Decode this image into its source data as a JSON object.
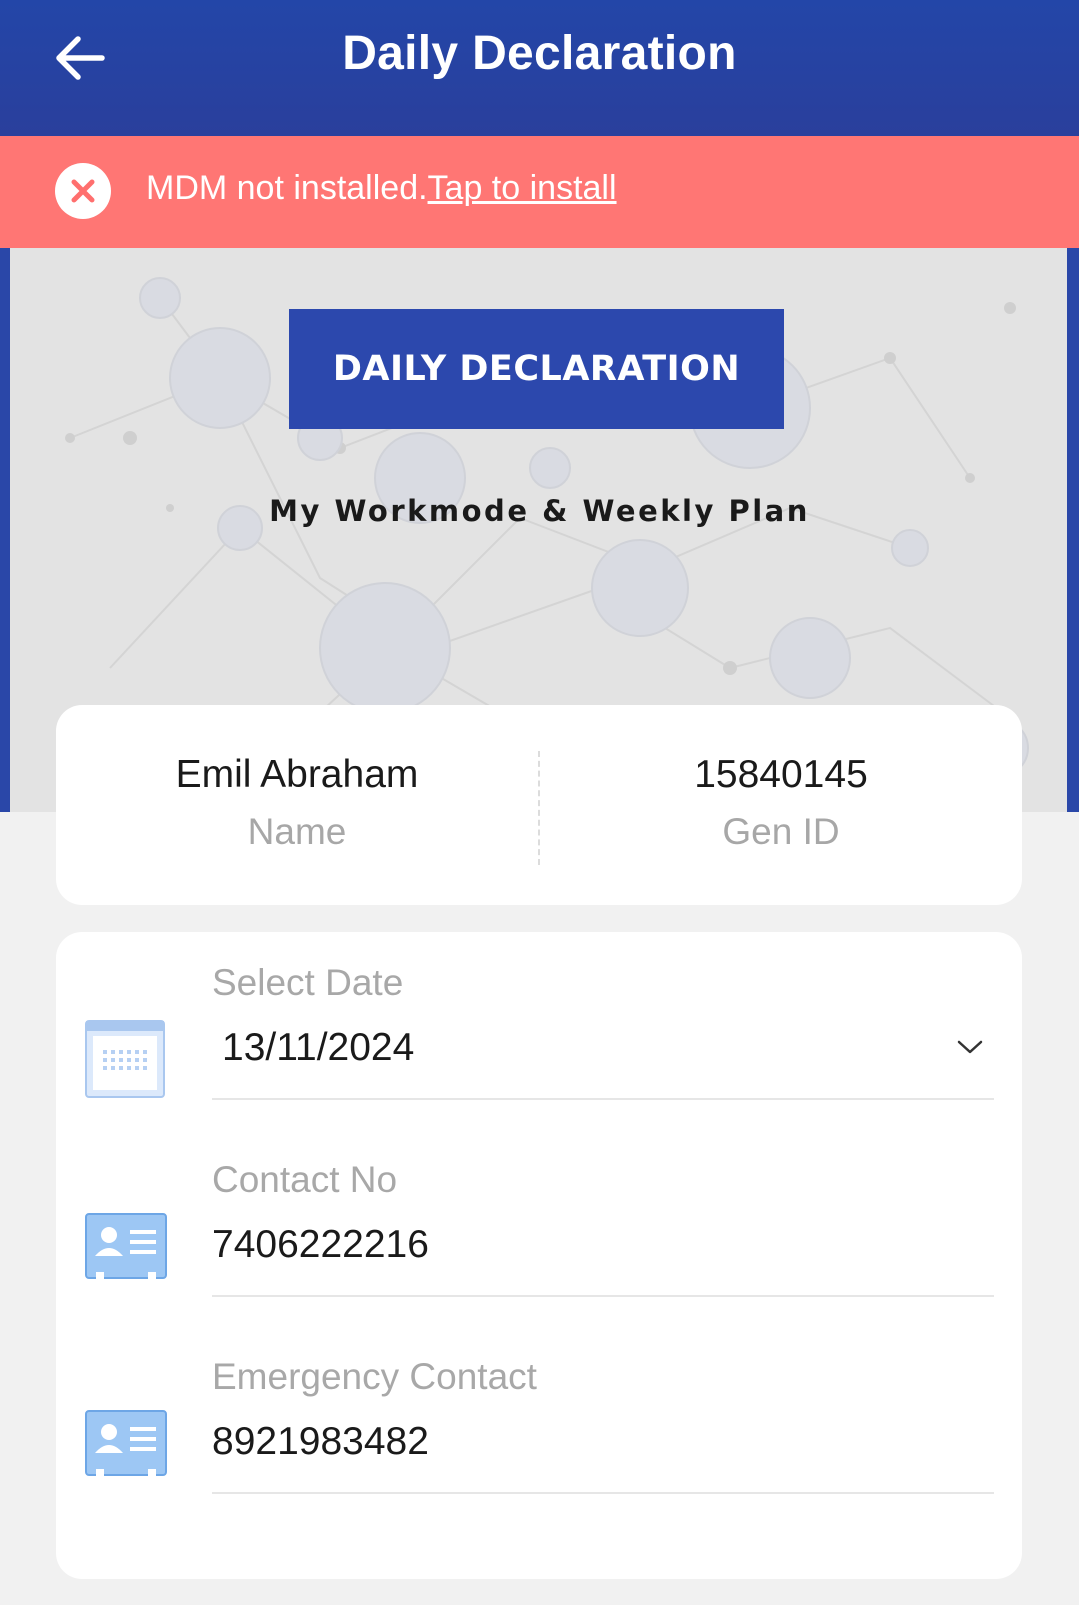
{
  "app_bar": {
    "title": "Daily Declaration",
    "back_icon": "arrow-left-icon"
  },
  "mdm_banner": {
    "icon": "close-circle-icon",
    "message": "MDM not installed.",
    "link": "Tap to install",
    "background": "#ff7674"
  },
  "hero": {
    "badge": "DAILY DECLARATION",
    "subtitle": "My Workmode & Weekly Plan",
    "badge_color": "#2c48ad"
  },
  "profile": {
    "name_value": "Emil Abraham",
    "name_label": "Name",
    "id_value": "15840145",
    "id_label": "Gen ID"
  },
  "form": {
    "date": {
      "label": "Select Date",
      "value": "13/11/2024",
      "icon": "calendar-icon",
      "dropdown_icon": "chevron-down-icon"
    },
    "contact": {
      "label": "Contact No",
      "value": "7406222216",
      "icon": "contact-card-icon"
    },
    "emergency": {
      "label": "Emergency Contact",
      "value": "8921983482",
      "icon": "contact-card-icon"
    }
  },
  "colors": {
    "primary": "#2346a8",
    "alert": "#ff7674",
    "page_background": "#f1f1f1"
  }
}
